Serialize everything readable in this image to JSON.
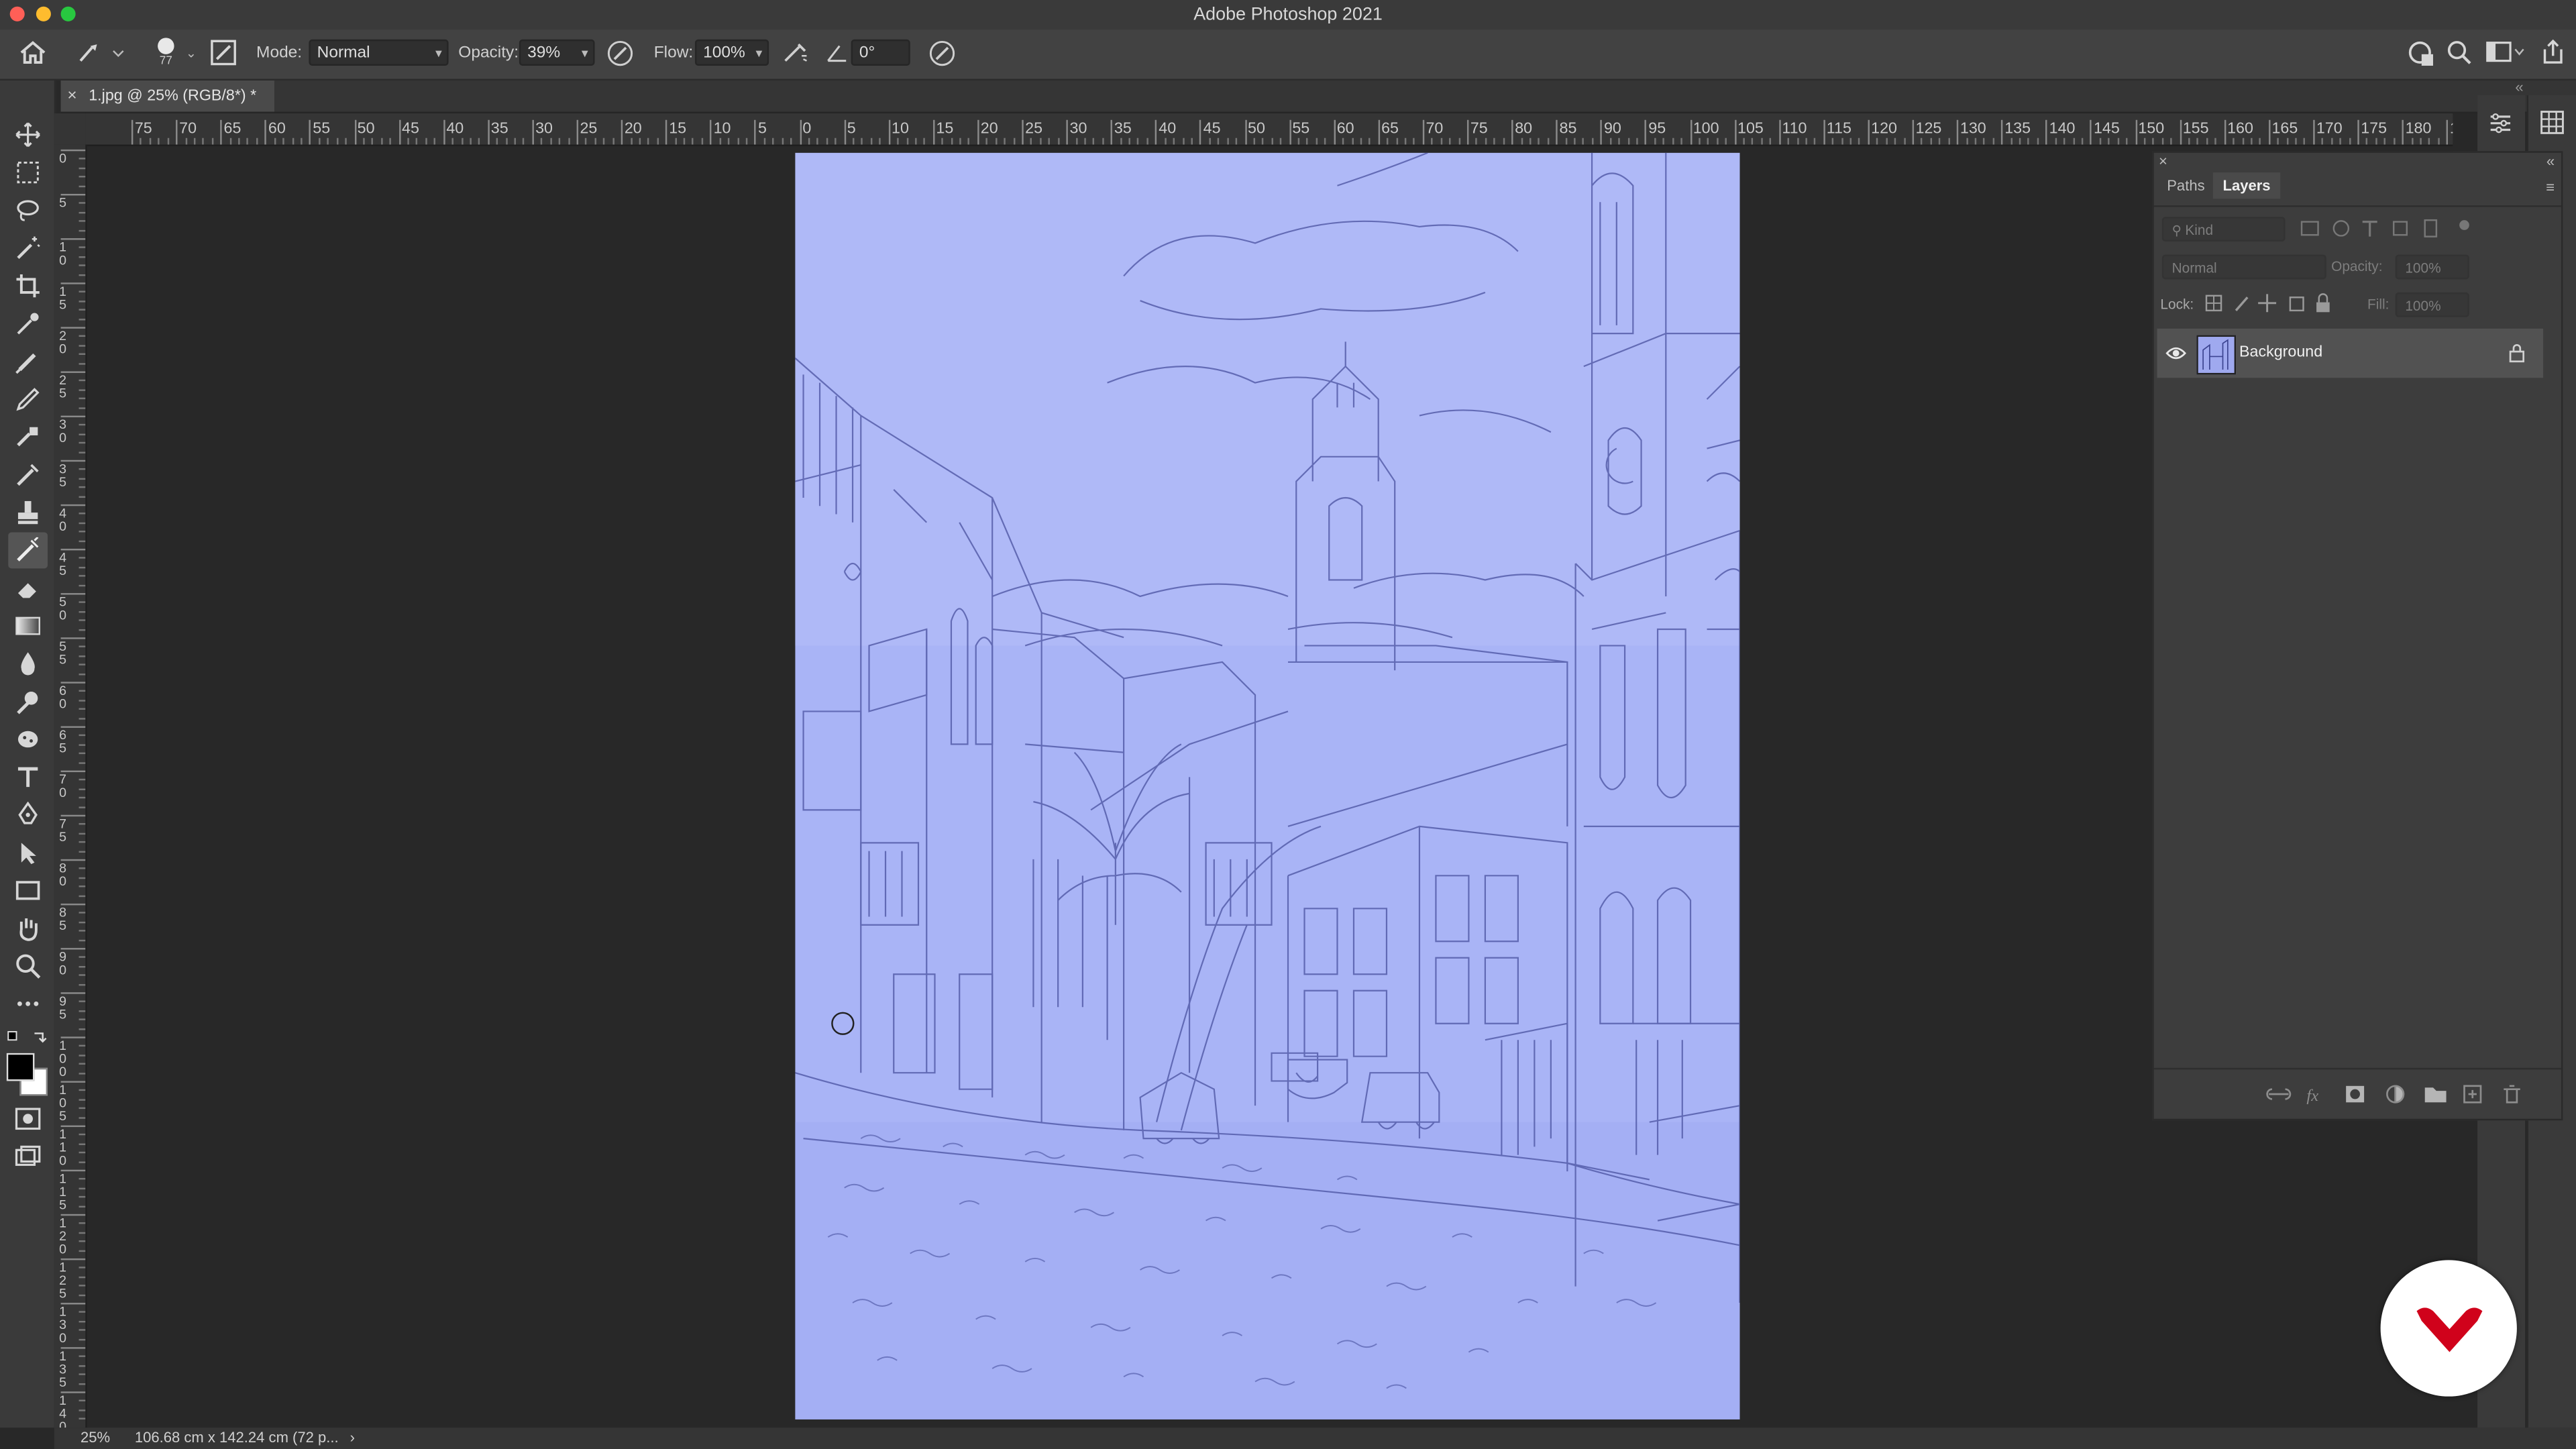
{
  "app": {
    "title": "Adobe Photoshop 2021"
  },
  "options_bar": {
    "brush_size": "77",
    "mode_label": "Mode:",
    "mode_value": "Normal",
    "opacity_label": "Opacity:",
    "opacity_value": "39%",
    "flow_label": "Flow:",
    "flow_value": "100%",
    "angle_value": "0°"
  },
  "document": {
    "tab_label": "1.jpg @ 25% (RGB/8*) *",
    "close_glyph": "×"
  },
  "ruler": {
    "h_labels": [
      "75",
      "70",
      "65",
      "60",
      "55",
      "50",
      "45",
      "40",
      "35",
      "30",
      "25",
      "20",
      "15",
      "10",
      "5",
      "0",
      "5",
      "10",
      "15",
      "20",
      "25",
      "30",
      "35",
      "40",
      "45",
      "50",
      "55",
      "60",
      "65",
      "70",
      "75",
      "80",
      "85",
      "90",
      "95",
      "100",
      "105",
      "110",
      "115",
      "120",
      "125",
      "130",
      "135",
      "140",
      "145",
      "150",
      "155",
      "160",
      "165",
      "170",
      "175",
      "180",
      "1"
    ],
    "v_labels": [
      "0",
      "5",
      "1 0",
      "1 5",
      "2 0",
      "2 5",
      "3 0",
      "3 5",
      "4 0",
      "4 5",
      "5 0",
      "5 5",
      "6 0",
      "6 5",
      "7 0",
      "7 5",
      "8 0",
      "8 5",
      "9 0",
      "9 5",
      "1 0 0",
      "1 0 5",
      "1 1 0",
      "1 1 5",
      "1 2 0",
      "1 2 5",
      "1 3 0",
      "1 3 5",
      "1 4 0"
    ]
  },
  "status": {
    "zoom": "25%",
    "doc_info": "106.68 cm x 142.24 cm (72 p...",
    "arrow": "›"
  },
  "layers_panel": {
    "tabs": [
      "Paths",
      "Layers"
    ],
    "active_tab": "Layers",
    "filter_placeholder": "Kind",
    "blend_mode": "Normal",
    "opacity_label": "Opacity:",
    "opacity_value": "100%",
    "lock_label": "Lock:",
    "fill_label": "Fill:",
    "fill_value": "100%",
    "layers": [
      {
        "name": "Background",
        "visible": true,
        "locked": true
      }
    ]
  },
  "colors": {
    "accent_red": "#d0021b",
    "paper_blue": "#a9b4f6",
    "traffic_close": "#ff5f57",
    "traffic_min": "#febc2e",
    "traffic_max": "#28c840"
  }
}
